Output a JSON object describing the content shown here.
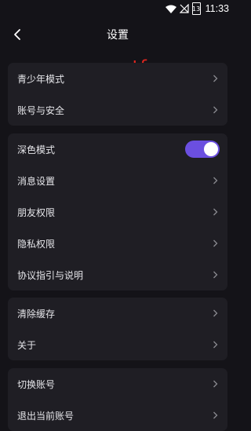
{
  "status_bar": {
    "battery": "13",
    "time": "11:33"
  },
  "header": {
    "title": "设置"
  },
  "watermark": "qqtf",
  "groups": [
    {
      "items": [
        {
          "label": "青少年模式"
        },
        {
          "label": "账号与安全"
        }
      ]
    },
    {
      "items": [
        {
          "label": "深色模式",
          "toggle_on": true
        },
        {
          "label": "消息设置"
        },
        {
          "label": "朋友权限"
        },
        {
          "label": "隐私权限"
        },
        {
          "label": "协议指引与说明"
        }
      ]
    },
    {
      "items": [
        {
          "label": "清除缓存"
        },
        {
          "label": "关于"
        }
      ]
    },
    {
      "items": [
        {
          "label": "切换账号"
        },
        {
          "label": "退出当前账号"
        }
      ]
    }
  ],
  "colors": {
    "background": "#141318",
    "card": "#1f1e24",
    "toggle_accent": "#6b4fe0",
    "watermark": "#e0261f"
  }
}
